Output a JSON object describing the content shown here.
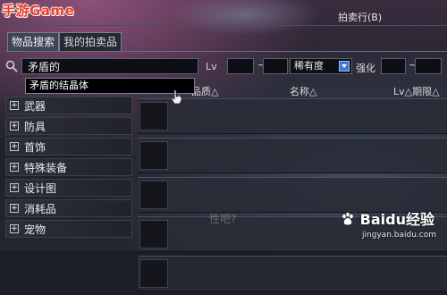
{
  "watermark": {
    "logo_text": "手游Game"
  },
  "window": {
    "title": "拍卖行(B)"
  },
  "tabs": [
    {
      "label": "物品搜索",
      "active": true
    },
    {
      "label": "我的拍卖品",
      "active": false
    }
  ],
  "search": {
    "value": "矛盾的",
    "level_label": "Lv",
    "level_separator": "~",
    "rarity_value": "稀有度",
    "enhance_label": "强化",
    "enhance_separator": "~",
    "suggestion": "矛盾的结晶体"
  },
  "columns": {
    "quality": "品质△",
    "name": "名称△",
    "level_period": "Lv△期限△"
  },
  "categories": [
    {
      "label": "武器"
    },
    {
      "label": "防具"
    },
    {
      "label": "首饰"
    },
    {
      "label": "特殊装备"
    },
    {
      "label": "设计图"
    },
    {
      "label": "消耗品"
    },
    {
      "label": "宠物"
    }
  ],
  "results": {
    "row_count": 5
  },
  "overlay": {
    "ghost_text": "性吧?"
  },
  "brand": {
    "name": "Baidu经验",
    "url": "jingyan.baidu.com"
  },
  "colors": {
    "accent_blue": "#3b7ad6",
    "logo_red": "#e8402a"
  }
}
